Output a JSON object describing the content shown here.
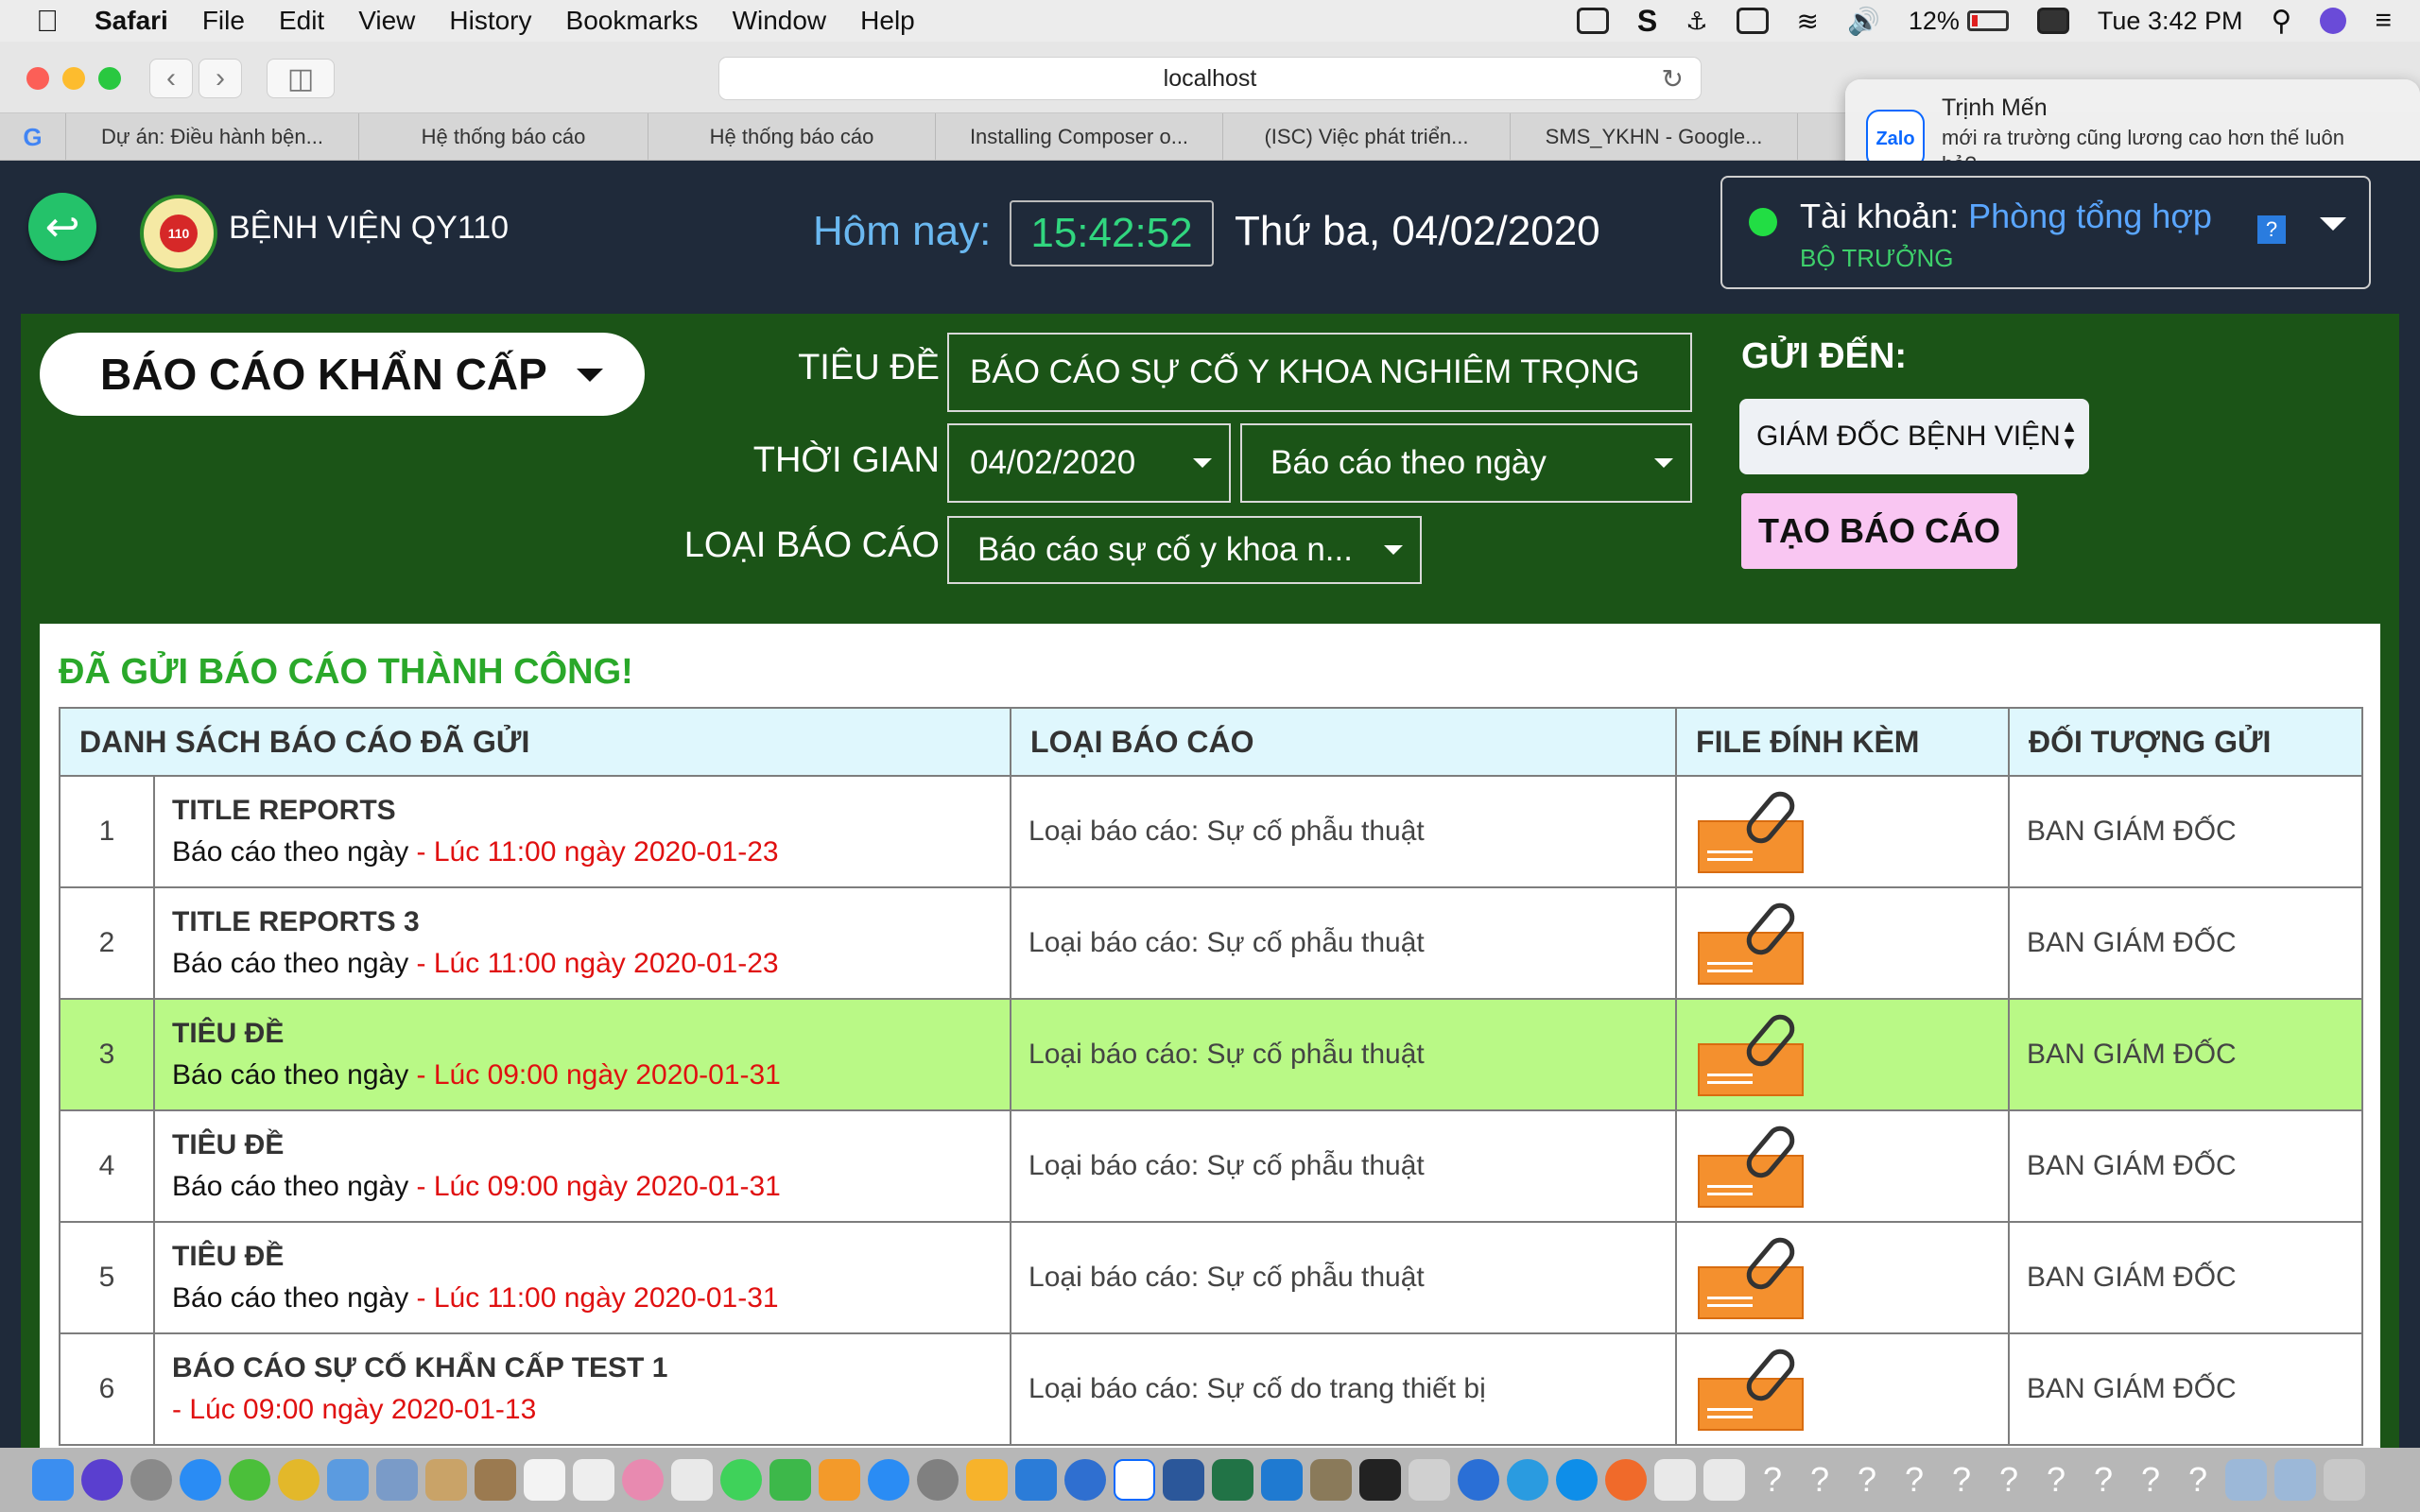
{
  "menubar": {
    "app_name": "Safari",
    "menus": [
      "File",
      "Edit",
      "View",
      "History",
      "Bookmarks",
      "Window",
      "Help"
    ],
    "battery_percent": "12%",
    "clock": "Tue 3:42 PM"
  },
  "browser": {
    "address": "localhost",
    "tabs": [
      "Dự án: Điều hành bện...",
      "Hệ thống báo cáo",
      "Hệ thống báo cáo",
      "Installing Composer o...",
      "(ISC) Việc phát triển...",
      "SMS_YKHN - Google..."
    ]
  },
  "notification": {
    "app": "Zalo",
    "sender": "Trịnh Mến",
    "message": "mới ra trường cũng lương cao hơn thế luôn hả?"
  },
  "header": {
    "hospital_name": "BỆNH VIỆN QY110",
    "logo_text": "110",
    "today_label": "Hôm nay:",
    "time": "15:42:52",
    "date": "Thứ ba, 04/02/2020",
    "account_label": "Tài khoản:",
    "account_name": "Phòng tổng hợp",
    "account_role": "BỘ TRƯỞNG",
    "help_icon": "?"
  },
  "form": {
    "report_type": "BÁO CÁO KHẨN CẤP",
    "title_label": "TIÊU ĐỀ",
    "title_value": "BÁO CÁO SỰ CỐ Y KHOA NGHIÊM TRỌNG",
    "time_label": "THỜI GIAN",
    "date_value": "04/02/2020",
    "period_value": "Báo cáo theo ngày",
    "category_label": "LOẠI BÁO CÁO",
    "category_value": "Báo cáo sự cố y khoa n...",
    "send_to_label": "GỬI ĐẾN:",
    "recipient": "GIÁM ĐỐC BỆNH VIỆN",
    "create_button": "TẠO BÁO CÁO"
  },
  "result": {
    "success_message": "ĐÃ GỬI BÁO CÁO THÀNH CÔNG!"
  },
  "table": {
    "headers": [
      "DANH SÁCH BÁO CÁO ĐÃ GỬI",
      "LOẠI BÁO CÁO",
      "FILE ĐÍNH KÈM",
      "ĐỐI TƯỢNG GỬI"
    ],
    "rows": [
      {
        "num": "1",
        "title": "TITLE REPORTS",
        "period": "Báo cáo theo ngày",
        "time": " - Lúc 11:00 ngày 2020-01-23",
        "type": "Loại báo cáo: Sự cố phẫu thuật",
        "recipient": "BAN GIÁM ĐỐC"
      },
      {
        "num": "2",
        "title": "TITLE REPORTS 3",
        "period": "Báo cáo theo ngày",
        "time": " - Lúc 11:00 ngày 2020-01-23",
        "type": "Loại báo cáo: Sự cố phẫu thuật",
        "recipient": "BAN GIÁM ĐỐC"
      },
      {
        "num": "3",
        "title": "TIÊU ĐỀ",
        "period": "Báo cáo theo ngày",
        "time": " - Lúc 09:00 ngày 2020-01-31",
        "type": "Loại báo cáo: Sự cố phẫu thuật",
        "recipient": "BAN GIÁM ĐỐC"
      },
      {
        "num": "4",
        "title": "TIÊU ĐỀ",
        "period": "Báo cáo theo ngày",
        "time": " - Lúc 09:00 ngày 2020-01-31",
        "type": "Loại báo cáo: Sự cố phẫu thuật",
        "recipient": "BAN GIÁM ĐỐC"
      },
      {
        "num": "5",
        "title": "TIÊU ĐỀ",
        "period": "Báo cáo theo ngày",
        "time": " - Lúc 11:00 ngày 2020-01-31",
        "type": "Loại báo cáo: Sự cố phẫu thuật",
        "recipient": "BAN GIÁM ĐỐC"
      },
      {
        "num": "6",
        "title": "BÁO CÁO SỰ CỐ KHẨN CẤP TEST 1",
        "period": "",
        "time": "- Lúc 09:00 ngày 2020-01-13",
        "type": "Loại báo cáo: Sự cố do trang thiết bị",
        "recipient": "BAN GIÁM ĐỐC"
      }
    ]
  },
  "colors": {
    "header_bg": "#1f2a3a",
    "panel_green": "#1b5417",
    "highlight_row": "#b9f986",
    "success_green": "#2aa82a",
    "time_red": "#e01010",
    "clock_green": "#31d67f",
    "create_button_bg": "#f9c6f2"
  }
}
